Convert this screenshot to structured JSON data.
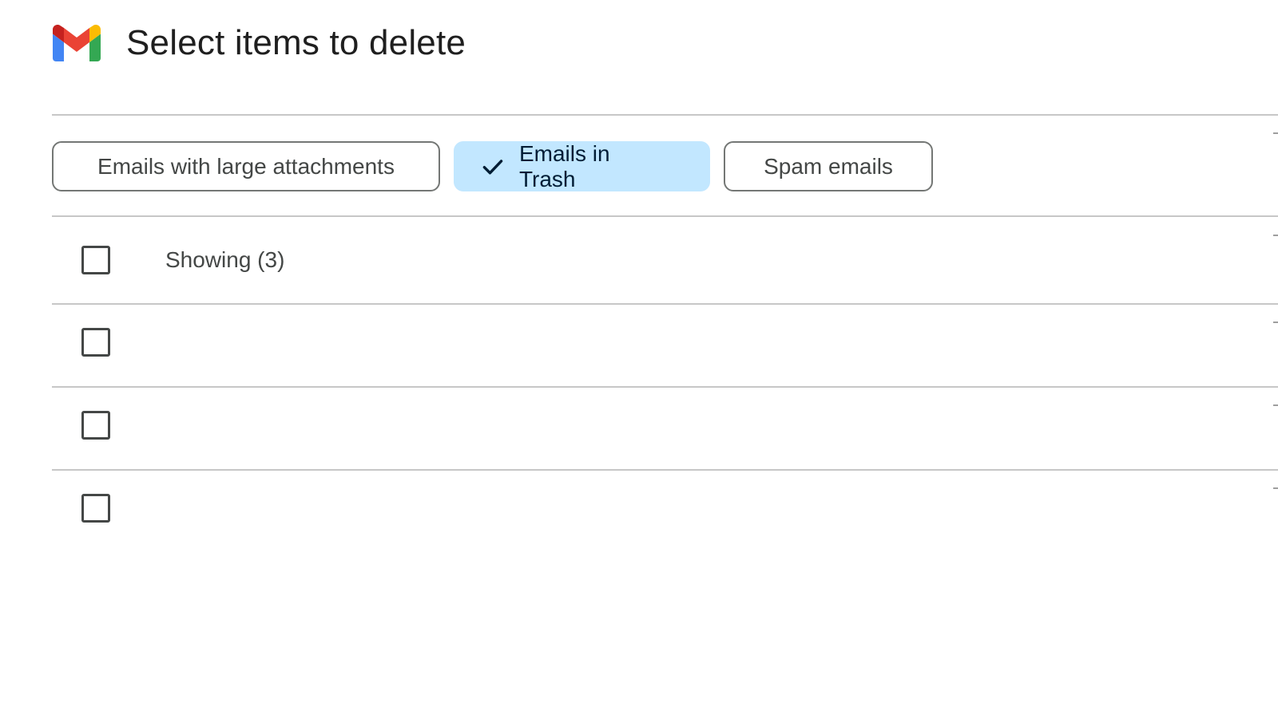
{
  "header": {
    "title": "Select items to delete",
    "logo_icon": "gmail-logo-icon"
  },
  "filters": [
    {
      "label": "Emails with large attachments",
      "selected": false
    },
    {
      "label": "Emails in Trash",
      "selected": true,
      "icon": "check-icon"
    },
    {
      "label": "Spam emails",
      "selected": false
    }
  ],
  "list": {
    "summary_label": "Showing (3)",
    "row_count": 3
  },
  "colors": {
    "selected_chip": "#c2e7ff",
    "chip_border": "#747775",
    "divider": "#c7c7c7",
    "gmail_red": "#ea4335",
    "gmail_blue": "#4285f4",
    "gmail_green": "#34a853",
    "gmail_yellow": "#fbbc04",
    "gmail_dark_red": "#c5221f"
  }
}
